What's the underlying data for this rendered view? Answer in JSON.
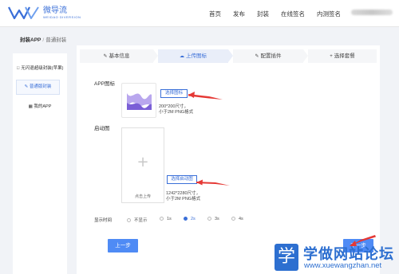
{
  "brand": {
    "name_cn": "微导流",
    "name_en": "WEIDAO DIVERSION",
    "color": "#3a6fd8"
  },
  "nav": {
    "items": [
      "首页",
      "发布",
      "封装",
      "在线签名",
      "内测签名"
    ]
  },
  "breadcrumb": {
    "root": "封装APP",
    "separator": "/",
    "current": "普通封装"
  },
  "sidebar": {
    "items": [
      {
        "label": "无闪退超级封装(苹果)",
        "icon": "apple-icon"
      },
      {
        "label": "普通版封装",
        "icon": "edit-icon",
        "active": true
      },
      {
        "label": "我的APP",
        "icon": "grid-icon"
      }
    ]
  },
  "steps": [
    {
      "label": "基本信息",
      "icon": "edit-icon"
    },
    {
      "label": "上传图标",
      "icon": "cloud-upload-icon",
      "active": true
    },
    {
      "label": "配置插件",
      "icon": "edit-icon"
    },
    {
      "label": "选择套餐",
      "icon": "plus-icon"
    }
  ],
  "app_icon": {
    "label": "APP图标",
    "button": "选择图标",
    "hint_line1": "200*200尺寸，",
    "hint_line2": "小于2M PNG格式"
  },
  "splash": {
    "label": "启动图",
    "upload_caption": "点击上传",
    "button": "选择启动图",
    "hint_line1": "1242*2280尺寸，",
    "hint_line2": "小于2M PNG格式"
  },
  "display_time": {
    "label": "显示时间",
    "options": [
      "不显示",
      "1s",
      "2s",
      "3s",
      "4s"
    ],
    "selected": "2s"
  },
  "buttons": {
    "prev": "上一步",
    "next": "下一步"
  },
  "annotation_color": "#e53935",
  "watermark": {
    "char": "学",
    "cn": "学做网站论坛",
    "url": "www.xuewangzhan.net"
  }
}
